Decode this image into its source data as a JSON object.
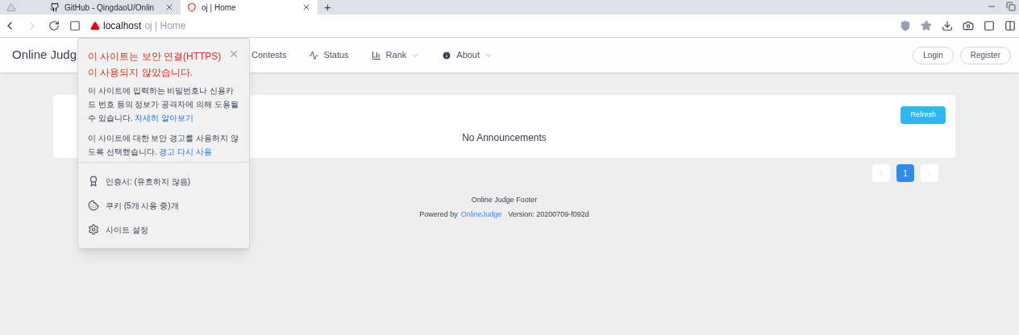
{
  "browser": {
    "tabs": [
      {
        "title": "GitHub - QingdaoU/Onlin",
        "selected": false,
        "kind": "github"
      },
      {
        "title": "oj | Home",
        "selected": true,
        "kind": "site"
      }
    ],
    "new_tab": "+",
    "address": {
      "host": "localhost",
      "title": "oj | Home"
    }
  },
  "nav": {
    "brand": "Online Judg",
    "items": [
      {
        "label": "Contests",
        "kind": "plain",
        "dropdown": false
      },
      {
        "label": "Status",
        "kind": "pulse",
        "dropdown": false
      },
      {
        "label": "Rank",
        "kind": "bars",
        "dropdown": true
      },
      {
        "label": "About",
        "kind": "info",
        "dropdown": true
      }
    ],
    "buttons": [
      "Login",
      "Register"
    ]
  },
  "announcements": {
    "refresh": "Refresh",
    "empty_text": "No Announcements"
  },
  "pagination": {
    "pages": [
      {
        "label": "1",
        "selected": true
      }
    ]
  },
  "footer": {
    "line": "Online Judge Footer",
    "powered_prefix": "Powered by",
    "link": "OnlineJudge",
    "version": "Version: 20200709-f092d"
  },
  "popup": {
    "title": "이 사이트는 보안 연결(HTTPS)이 사용되지 않았습니다.",
    "paragraphs": [
      {
        "text": "이 사이트에 입력하는 비밀번호나 신용카드 번호 등의 정보가 공격자에 의해 도용될 수 있습니다.",
        "link": "자세히 알아보기"
      },
      {
        "text": "이 사이트에 대한 보안 경고를 사용하지 않도록 선택했습니다.",
        "link": "경고 다시 사용"
      }
    ],
    "items": [
      {
        "label": "인증서: (유효하지 않음)",
        "kind": "certificate"
      },
      {
        "label": "쿠키 (5개 사용 중)개",
        "kind": "cookie"
      },
      {
        "label": "사이트 설정",
        "kind": "settings"
      }
    ]
  }
}
